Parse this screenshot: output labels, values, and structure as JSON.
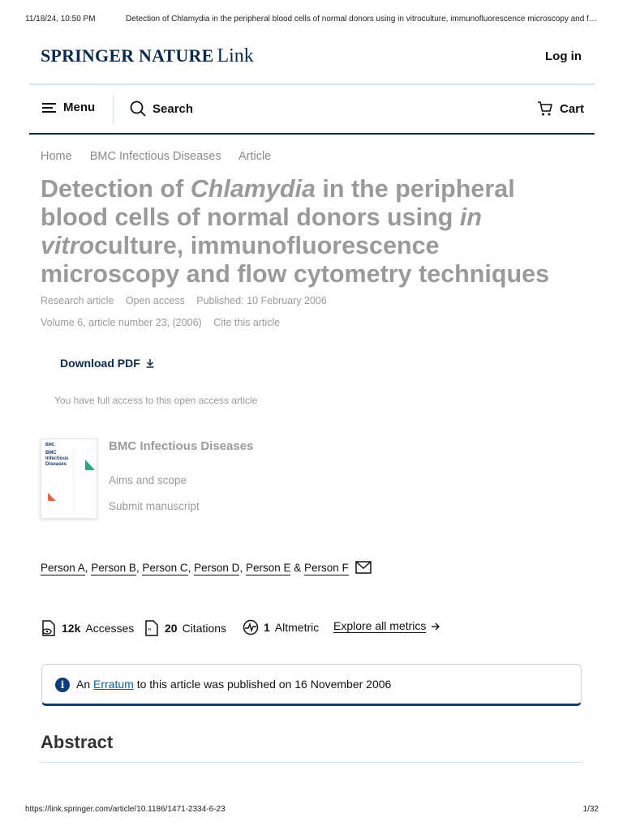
{
  "print_header": {
    "datetime": "11/18/24, 10:50 PM",
    "doc_title": "Detection of Chlamydia in the peripheral blood cells of normal donors using in vitroculture, immunofluorescence microscopy and f…"
  },
  "print_footer": {
    "url": "https://link.springer.com/article/10.1186/1471-2334-6-23",
    "page": "1/32"
  },
  "header": {
    "brand": "SPRINGER NATURE",
    "brand_suffix": "Link",
    "login_label": "Log in"
  },
  "nav": {
    "menu_label": "Menu",
    "search_label": "Search",
    "cart_label": "Cart"
  },
  "breadcrumb": [
    "Home",
    "BMC Infectious Diseases",
    "Article"
  ],
  "article": {
    "title_part1": "Detection of ",
    "title_italic1": "Chlamydia",
    "title_part2": " in the peripheral blood cells of normal donors using ",
    "title_italic2": "in vitro",
    "title_part3": "culture, immunofluorescence microscopy and flow cytometry techniques",
    "type": "Research article",
    "access": "Open access",
    "published": "Published: 10 February 2006",
    "volume": "Volume 6, article number 23, (2006)",
    "cite": "Cite this article"
  },
  "download_label": "Download PDF",
  "access_note": "You have full access to this open access article",
  "journal": {
    "cover_brand": "BMC",
    "cover_title": "BMC Infectious Diseases",
    "name": "BMC Infectious Diseases",
    "aims_label": "Aims and scope",
    "submit_label": "Submit manuscript"
  },
  "authors": [
    "Person A",
    "Person B",
    "Person C",
    "Person D",
    "Person E",
    "Person F"
  ],
  "author_separator": ", ",
  "author_last_separator": " & ",
  "metrics": {
    "accesses_value": "12k",
    "accesses_label": "Accesses",
    "citations_value": "20",
    "citations_label": "Citations",
    "altmetric_value": "1",
    "altmetric_label": "Altmetric",
    "explore_label": "Explore all metrics"
  },
  "erratum": {
    "icon": "info-icon",
    "prefix": "An ",
    "link_text": "Erratum",
    "suffix": " to this article was published on 16 November 2006"
  },
  "abstract_heading": "Abstract",
  "colors": {
    "brand_navy": "#0a2a4a",
    "accent_blue": "#0a3d7a",
    "link_blue": "#0a5fa0",
    "muted_gray": "#9a9a9a"
  }
}
